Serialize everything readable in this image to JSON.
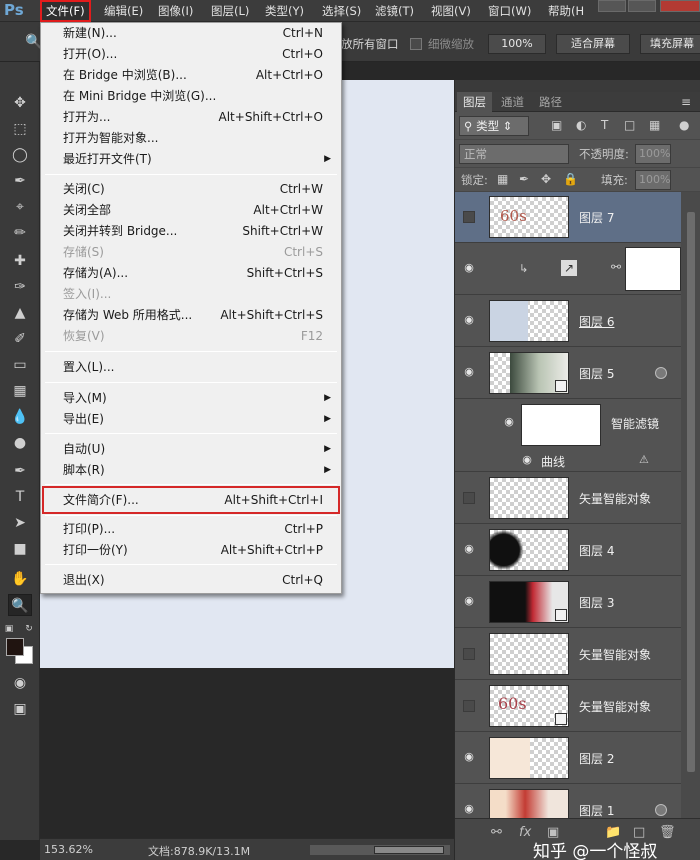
{
  "app": {
    "logo": "Ps",
    "colors": {
      "menu_bg": "#3c3c3c",
      "panel_bg": "#535353",
      "highlight_outline": "#e21c1c",
      "canvas": "#e1e7f2",
      "selected_layer": "#5f6f87"
    }
  },
  "menubar": {
    "items": [
      {
        "label": "文件(F)",
        "active": true
      },
      {
        "label": "编辑(E)"
      },
      {
        "label": "图像(I)"
      },
      {
        "label": "图层(L)"
      },
      {
        "label": "类型(Y)"
      },
      {
        "label": "选择(S)"
      },
      {
        "label": "滤镜(T)"
      },
      {
        "label": "视图(V)"
      },
      {
        "label": "窗口(W)"
      },
      {
        "label": "帮助(H"
      }
    ]
  },
  "options_bar": {
    "resize_all_windows": "放所有窗口",
    "scrubby_zoom": "细微缩放",
    "zoom_100": "100%",
    "fit_screen": "适合屏幕",
    "fill_screen": "填充屏幕"
  },
  "file_menu": {
    "items": [
      {
        "label": "新建(N)...",
        "shortcut": "Ctrl+N"
      },
      {
        "label": "打开(O)...",
        "shortcut": "Ctrl+O"
      },
      {
        "label": "在 Bridge 中浏览(B)...",
        "shortcut": "Alt+Ctrl+O"
      },
      {
        "label": "在 Mini Bridge 中浏览(G)...",
        "shortcut": ""
      },
      {
        "label": "打开为...",
        "shortcut": "Alt+Shift+Ctrl+O"
      },
      {
        "label": "打开为智能对象...",
        "shortcut": ""
      },
      {
        "label": "最近打开文件(T)",
        "shortcut": "",
        "submenu": true
      },
      {
        "label": "关闭(C)",
        "shortcut": "Ctrl+W"
      },
      {
        "label": "关闭全部",
        "shortcut": "Alt+Ctrl+W"
      },
      {
        "label": "关闭并转到 Bridge...",
        "shortcut": "Shift+Ctrl+W"
      },
      {
        "label": "存储(S)",
        "shortcut": "Ctrl+S",
        "disabled": true
      },
      {
        "label": "存储为(A)...",
        "shortcut": "Shift+Ctrl+S"
      },
      {
        "label": "签入(I)...",
        "shortcut": "",
        "disabled": true
      },
      {
        "label": "存储为 Web 所用格式...",
        "shortcut": "Alt+Shift+Ctrl+S"
      },
      {
        "label": "恢复(V)",
        "shortcut": "F12",
        "disabled": true
      },
      {
        "label": "置入(L)...",
        "shortcut": ""
      },
      {
        "label": "导入(M)",
        "shortcut": "",
        "submenu": true
      },
      {
        "label": "导出(E)",
        "shortcut": "",
        "submenu": true
      },
      {
        "label": "自动(U)",
        "shortcut": "",
        "submenu": true
      },
      {
        "label": "脚本(R)",
        "shortcut": "",
        "submenu": true
      },
      {
        "label": "文件简介(F)...",
        "shortcut": "Alt+Shift+Ctrl+I",
        "highlighted": true
      },
      {
        "label": "打印(P)...",
        "shortcut": "Ctrl+P"
      },
      {
        "label": "打印一份(Y)",
        "shortcut": "Alt+Shift+Ctrl+P"
      },
      {
        "label": "退出(X)",
        "shortcut": "Ctrl+Q"
      }
    ]
  },
  "layers_panel": {
    "tabs": [
      "图层",
      "通道",
      "路径"
    ],
    "filter_kind": "类型",
    "blend_mode": "正常",
    "opacity_label": "不透明度:",
    "opacity_value": "100%",
    "lock_label": "锁定:",
    "fill_label": "填充:",
    "fill_value": "100%",
    "layers": [
      {
        "name": "图层 7",
        "visible": false,
        "selected": true,
        "thumb": "60s"
      },
      {
        "name": "",
        "visible": true,
        "adjustment": true
      },
      {
        "name": "图层 6",
        "visible": true,
        "underline": true
      },
      {
        "name": "图层 5",
        "visible": true,
        "smart": true
      },
      {
        "name": "智能滤镜",
        "visible": true,
        "sub": true
      },
      {
        "name": "曲线",
        "visible": true,
        "filter": true
      },
      {
        "name": "矢量智能对象",
        "visible": false
      },
      {
        "name": "图层 4",
        "visible": true
      },
      {
        "name": "图层 3",
        "visible": true,
        "smart": true
      },
      {
        "name": "矢量智能对象",
        "visible": false
      },
      {
        "name": "矢量智能对象",
        "visible": false,
        "smart": true,
        "thumb": "60s"
      },
      {
        "name": "图层 2",
        "visible": true
      },
      {
        "name": "图层 1",
        "visible": true
      }
    ],
    "thumb_text": "60s"
  },
  "status_bar": {
    "zoom": "153.62%",
    "doc": "文档:878.9K/13.1M"
  },
  "watermark": "知乎 @一个怪叔"
}
